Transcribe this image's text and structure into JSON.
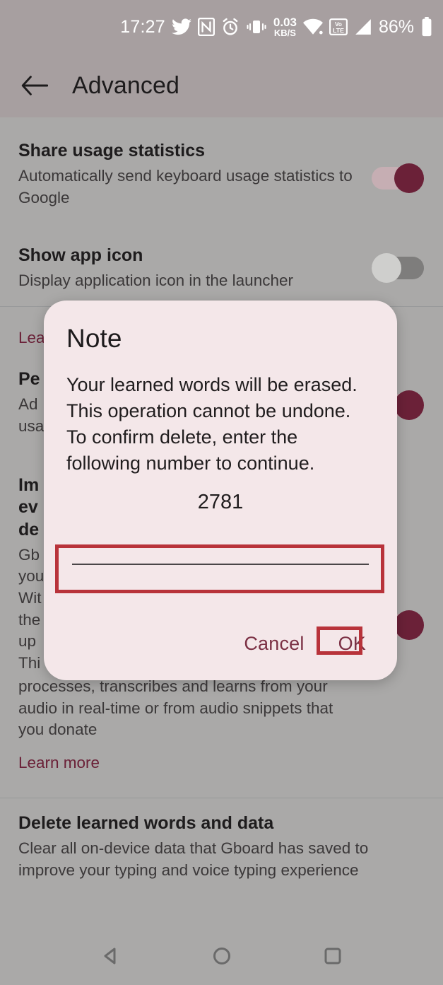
{
  "statusbar": {
    "time": "17:27",
    "battery_percent": "86%",
    "data_rate_value": "0.03",
    "data_rate_unit": "KB/S",
    "volte_top": "Vo",
    "volte_bottom": "LTE",
    "icons": [
      "twitter-icon",
      "nfc-icon",
      "alarm-icon",
      "vibrate-icon",
      "data-rate-icon",
      "wifi-icon",
      "volte-icon",
      "signal-icon",
      "battery-icon"
    ]
  },
  "appbar": {
    "back_label": "back-arrow",
    "title": "Advanced"
  },
  "settings": [
    {
      "title": "Share usage statistics",
      "subtitle": "Automatically send keyboard usage statistics to Google",
      "toggle": "on"
    },
    {
      "title": "Show app icon",
      "subtitle": "Display application icon in the launcher",
      "toggle": "off"
    }
  ],
  "obscured": {
    "learn_more_top": "Lea",
    "personalize_title": "Pe",
    "personalize_sub_1": "Ad",
    "personalize_sub_2": "usa",
    "improve_title_1": "Im",
    "improve_title_2": "ev",
    "improve_title_3": "de",
    "improve_sub_1": "Gb",
    "improve_sub_2": "you",
    "improve_sub_3": "Wit",
    "improve_sub_4": "the",
    "improve_sub_5": "up",
    "improve_sub_6": "Thi"
  },
  "voice_section": {
    "line_partial": "processes, transcribes and learns from your",
    "line_2": "audio in real-time or from audio snippets that",
    "line_3": "you donate",
    "learn_more": "Learn more"
  },
  "delete_section": {
    "title": "Delete learned words and data",
    "subtitle": "Clear all on-device data that Gboard has saved to improve your typing and voice typing experience"
  },
  "dialog": {
    "title": "Note",
    "message": "Your learned words will be erased. This operation cannot be undone. To confirm delete, enter the following number to continue.",
    "confirm_number": "2781",
    "input_value": "",
    "input_placeholder": "",
    "cancel_label": "Cancel",
    "ok_label": "OK"
  },
  "navbar": {
    "back": "nav-back-icon",
    "home": "nav-home-icon",
    "recents": "nav-recents-icon"
  },
  "colors": {
    "accent": "#6b2138",
    "dialog_bg": "#f4e7e9",
    "page_bg": "#aaa9a8",
    "appbar_bg": "#a79fa0",
    "annotation": "#b8333a"
  }
}
